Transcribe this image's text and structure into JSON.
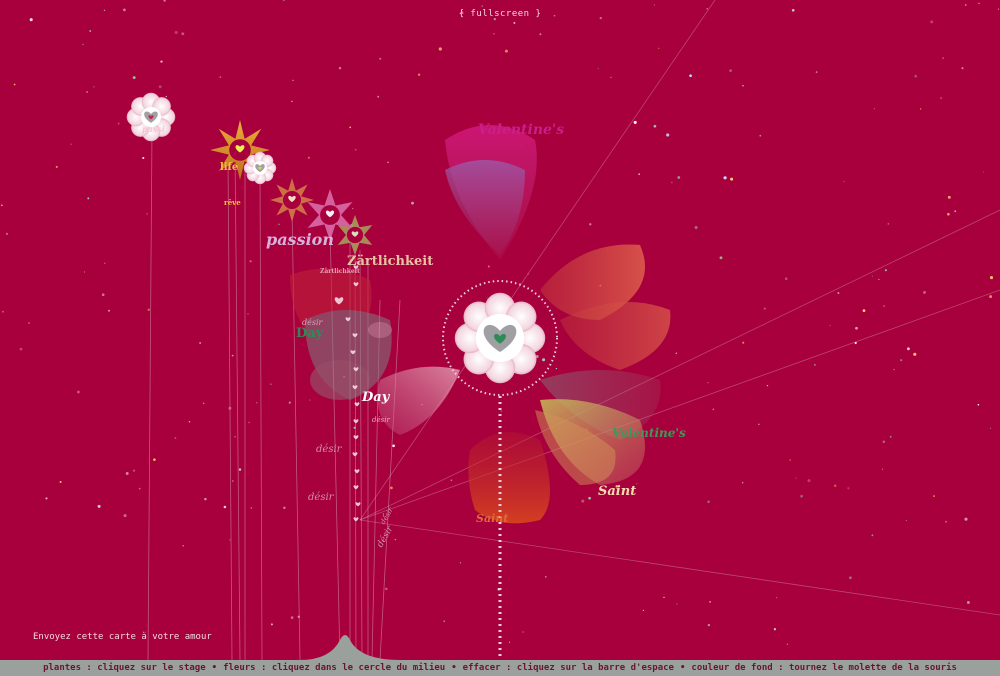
{
  "header": {
    "fullscreen_label": "{ fullscreen }"
  },
  "footer": {
    "send_card_label": "Envoyez cette carte à votre amour",
    "instructions": [
      "plantes : cliquez sur le stage",
      "fleurs : cliquez dans le cercle du milieu",
      "effacer : cliquez sur la barre d'espace",
      "couleur de fond : tournez le molette de la souris"
    ],
    "separator": "•"
  },
  "words": {
    "valentines_top": "Valentine's",
    "valentines_right": "Valentine's",
    "saint_right": "Saint",
    "saint_bottom": "Saint",
    "day_center": "Day",
    "day_left": "Day",
    "passion": "passion",
    "zartlichkeit": "Zärtlichkeit",
    "zartlichkeit_small": "Zärtlichkeit",
    "life": "life",
    "reve": "rêve",
    "passi": "passi",
    "desir_1": "désir",
    "desir_2": "désir",
    "desir_3": "désir",
    "desir_4": "désir",
    "desir_5": "désir",
    "desir_6": "désir"
  },
  "colors": {
    "background": "#a8003c",
    "bar": "#9aa19c",
    "accent_green": "#2e8b57"
  }
}
